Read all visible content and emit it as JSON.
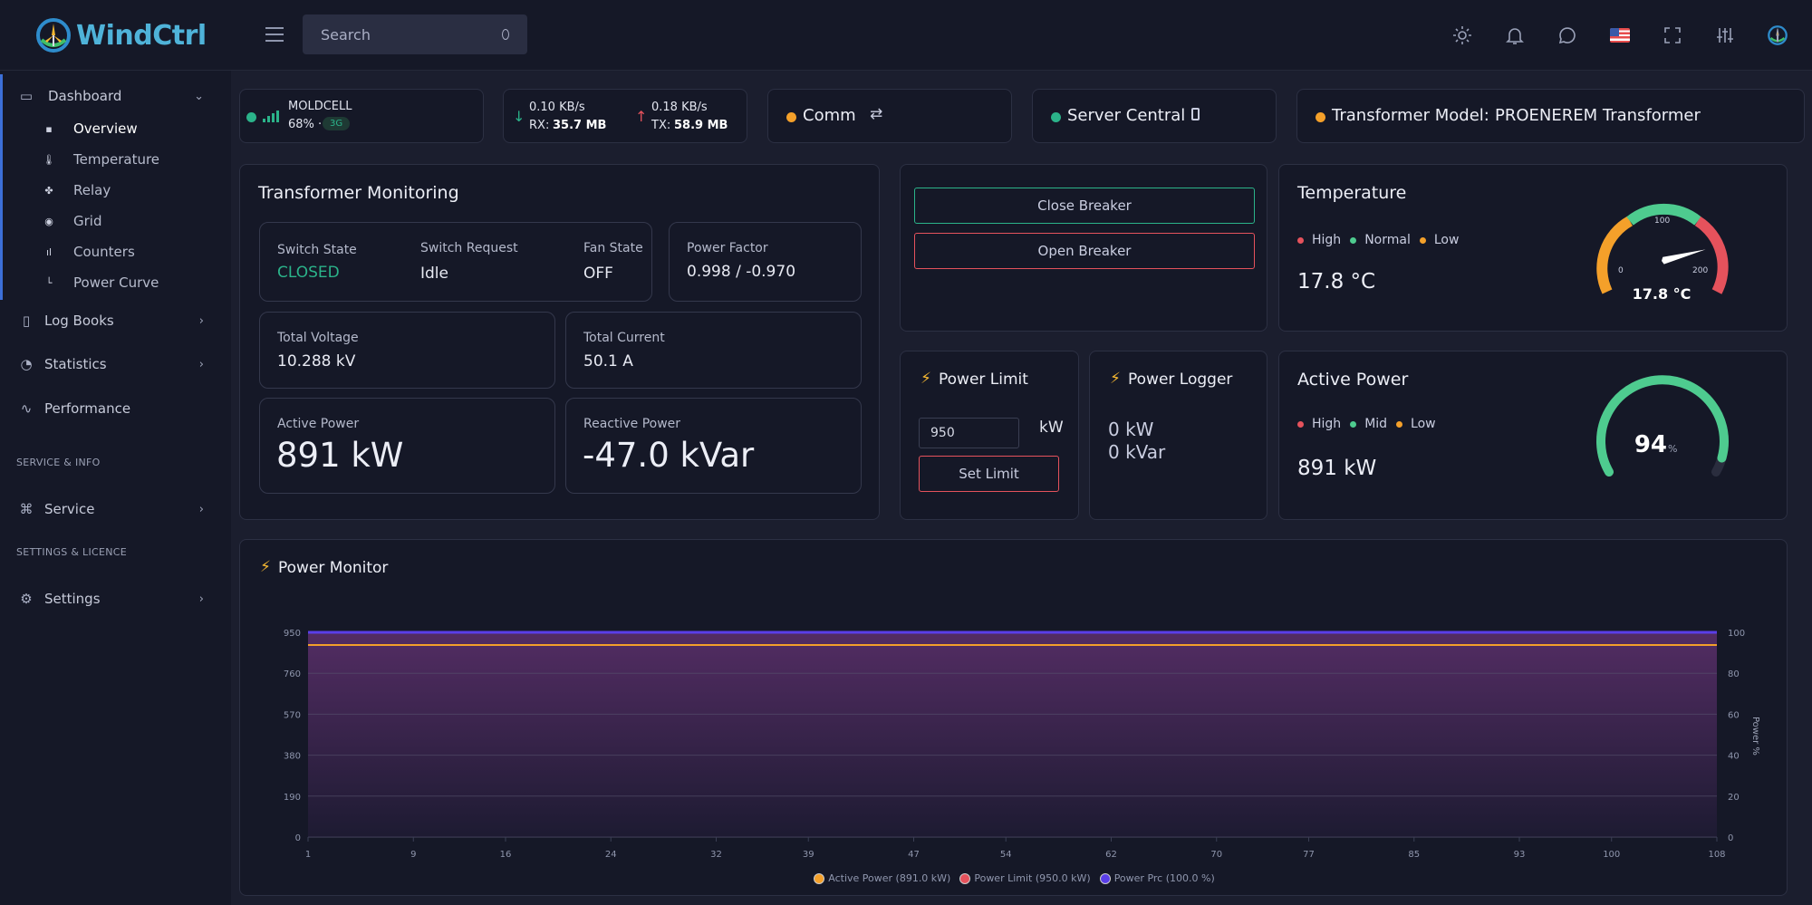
{
  "app": {
    "name": "WindCtrl"
  },
  "search": {
    "placeholder": "Search"
  },
  "sidebar": {
    "dashboard": "Dashboard",
    "sub_items": [
      {
        "label": "Overview"
      },
      {
        "label": "Temperature"
      },
      {
        "label": "Relay"
      },
      {
        "label": "Grid"
      },
      {
        "label": "Counters"
      },
      {
        "label": "Power Curve"
      }
    ],
    "log_books": "Log Books",
    "statistics": "Statistics",
    "performance": "Performance",
    "section_service": "SERVICE & INFO",
    "service": "Service",
    "section_settings": "SETTINGS & LICENCE",
    "settings": "Settings"
  },
  "status": {
    "modem_name": "MOLDCELL",
    "signal": "68% ·",
    "network": "3G",
    "rx_rate": "0.10 KB/s",
    "rx_label": "RX:",
    "rx_total": "35.7 MB",
    "tx_rate": "0.18 KB/s",
    "tx_label": "TX:",
    "tx_total": "58.9 MB",
    "comm": "Comm",
    "server": "Server Central",
    "transformer_label": "Transformer Model:",
    "transformer_model": "PROENEREM Transformer"
  },
  "monitoring": {
    "title": "Transformer Monitoring",
    "switch_state_label": "Switch State",
    "switch_state": "CLOSED",
    "switch_request_label": "Switch Request",
    "switch_request": "Idle",
    "fan_state_label": "Fan State",
    "fan_state": "OFF",
    "power_factor_label": "Power Factor",
    "power_factor": "0.998 / -0.970",
    "total_voltage_label": "Total Voltage",
    "total_voltage": "10.288 kV",
    "total_current_label": "Total Current",
    "total_current": "50.1 A",
    "active_power_label": "Active Power",
    "active_power": "891 kW",
    "reactive_power_label": "Reactive Power",
    "reactive_power": "-47.0 kVar"
  },
  "breaker": {
    "close": "Close Breaker",
    "open": "Open Breaker"
  },
  "temperature": {
    "title": "Temperature",
    "legend_high": "High",
    "legend_normal": "Normal",
    "legend_low": "Low",
    "value": "17.8 °C",
    "gauge_label": "17.8 °C",
    "gauge_min": "0",
    "gauge_mid": "100",
    "gauge_max": "200",
    "gauge_value": 17.8,
    "gauge_range": [
      0,
      200
    ]
  },
  "power_limit": {
    "title": "Power Limit",
    "input_value": "950",
    "unit": "kW",
    "button": "Set Limit"
  },
  "power_logger": {
    "title": "Power Logger",
    "kw": "0 kW",
    "kvar": "0 kVar"
  },
  "active_power": {
    "title": "Active Power",
    "legend_high": "High",
    "legend_mid": "Mid",
    "legend_low": "Low",
    "value": "891 kW",
    "gauge_percent": "94",
    "gauge_unit": "%",
    "gauge_fraction": 0.94
  },
  "colors": {
    "accent_green": "#2bb38a",
    "orange": "#f4a02a",
    "red": "#e5525c",
    "green": "#4ecb8f",
    "purple": "#5a3ee8",
    "blue_active": "#3c6fd8"
  },
  "power_monitor": {
    "title": "Power Monitor"
  },
  "chart_data": {
    "type": "area",
    "x": [
      1,
      9,
      16,
      24,
      32,
      39,
      47,
      54,
      62,
      70,
      77,
      85,
      93,
      100,
      108
    ],
    "x_ticks": [
      "1",
      "9",
      "16",
      "24",
      "32",
      "39",
      "47",
      "54",
      "62",
      "70",
      "77",
      "85",
      "93",
      "100",
      "108"
    ],
    "y_ticks_left": [
      "950",
      "760",
      "570",
      "380",
      "190",
      "0"
    ],
    "y_ticks_right": [
      "100",
      "80",
      "60",
      "40",
      "20",
      "0"
    ],
    "ylim_left": [
      0,
      950
    ],
    "ylim_right": [
      0,
      100
    ],
    "ylabel_right": "Power %",
    "series": [
      {
        "name": "Active Power (891.0 kW)",
        "axis": "left",
        "color": "#f4a02a",
        "values": [
          891,
          891,
          891,
          891,
          891,
          891,
          891,
          891,
          891,
          891,
          891,
          891,
          891,
          891,
          891
        ]
      },
      {
        "name": "Power Limit (950.0 kW)",
        "axis": "left",
        "color": "#e5525c",
        "values": [
          950,
          950,
          950,
          950,
          950,
          950,
          950,
          950,
          950,
          950,
          950,
          950,
          950,
          950,
          950
        ]
      },
      {
        "name": "Power Prc (100.0 %)",
        "axis": "right",
        "color": "#5a3ee8",
        "values": [
          100,
          100,
          100,
          100,
          100,
          100,
          100,
          100,
          100,
          100,
          100,
          100,
          100,
          100,
          100
        ]
      }
    ],
    "legend_position": "bottom"
  }
}
